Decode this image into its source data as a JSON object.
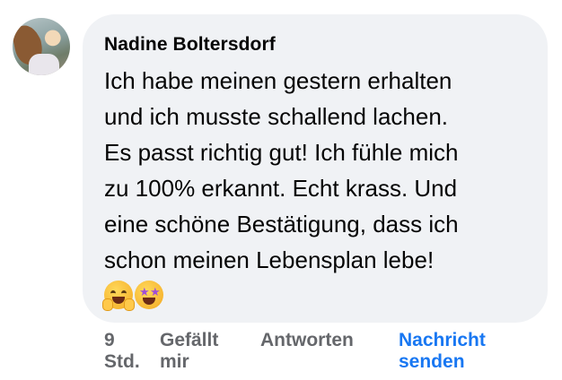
{
  "comment": {
    "author": "Nadine Boltersdorf",
    "lines": [
      "Ich habe meinen gestern erhalten",
      "und ich musste schallend lachen.",
      "Es passt richtig gut! Ich fühle mich",
      "zu 100% erkannt. Echt krass. Und",
      "eine schöne Bestätigung, dass ich",
      "schon meinen Lebensplan lebe!"
    ],
    "emojis": [
      "hugging-face-icon",
      "star-struck-icon"
    ]
  },
  "actions": {
    "timestamp_line1": "9",
    "timestamp_line2": "Std.",
    "like_line1": "Gefällt",
    "like_line2": "mir",
    "reply": "Antworten",
    "message_line1": "Nachricht",
    "message_line2": "senden",
    "message_color": "#1877f2",
    "muted_color": "#65676b"
  },
  "colors": {
    "bubble": "#f0f2f5",
    "text": "#050505"
  }
}
